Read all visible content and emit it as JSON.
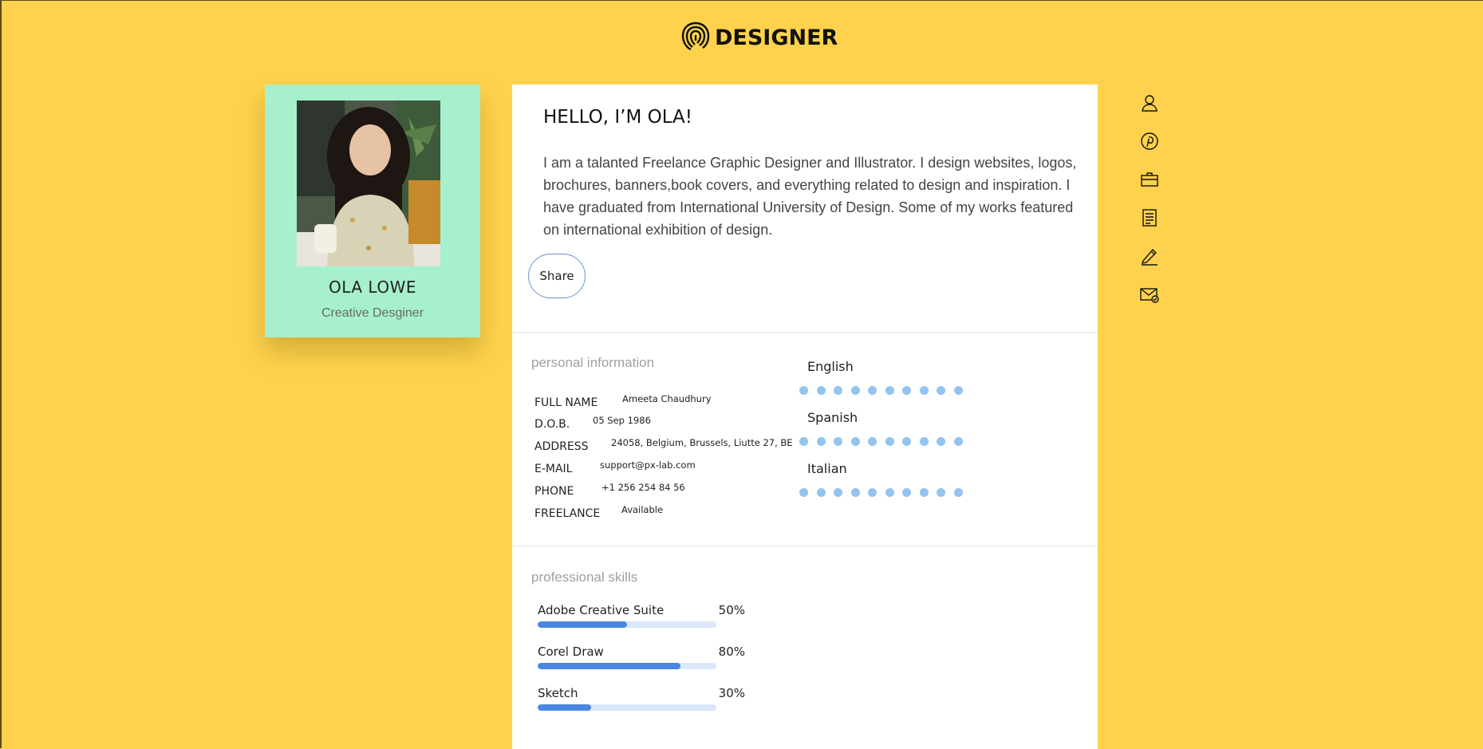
{
  "brand": {
    "logo_text": "DESIGNER",
    "logo_icon": "fingerprint-icon"
  },
  "profile": {
    "name": "OLA LOWE",
    "role": "Creative Desginer",
    "photo": "profile-photo"
  },
  "about": {
    "heading": "HELLO, I’M OLA!",
    "bio": "I am a talanted Freelance Graphic Designer and Illustrator. I design websites, logos, brochures, banners,book covers, and everything related to design and inspiration. I have graduated from International University of Design. Some of my works featured on international exhibition of design.",
    "share_label": "Share"
  },
  "personal": {
    "title": "personal information",
    "rows": [
      {
        "label": "FULL NAME",
        "value": "Ameeta Chaudhury"
      },
      {
        "label": "D.O.B.",
        "value": "05 Sep 1986"
      },
      {
        "label": "ADDRESS",
        "value": "24058, Belgium, Brussels, Liutte 27, BE"
      },
      {
        "label": "E-MAIL",
        "value": "support@px-lab.com"
      },
      {
        "label": "PHONE",
        "value": "+1 256 254 84 56"
      },
      {
        "label": "FREELANCE",
        "value": "Available"
      }
    ]
  },
  "languages": [
    {
      "name": "English",
      "dots": 10
    },
    {
      "name": "Spanish",
      "dots": 10
    },
    {
      "name": "Italian",
      "dots": 10
    }
  ],
  "skills": {
    "title": "professional skills",
    "items": [
      {
        "name": "Adobe Creative Suite",
        "percent_label": "50%",
        "level": 0.5
      },
      {
        "name": "Corel Draw",
        "percent_label": "80%",
        "level": 0.8
      },
      {
        "name": "Sketch",
        "percent_label": "30%",
        "level": 0.3
      }
    ]
  },
  "side_nav": [
    {
      "icon": "user-icon"
    },
    {
      "icon": "pinterest-icon"
    },
    {
      "icon": "briefcase-icon"
    },
    {
      "icon": "document-icon"
    },
    {
      "icon": "pencil-icon"
    },
    {
      "icon": "mail-icon"
    }
  ],
  "colors": {
    "background": "#fed24c",
    "card": "#a6f0cd",
    "accent": "#4a87e3",
    "dot": "#94c3ee"
  }
}
